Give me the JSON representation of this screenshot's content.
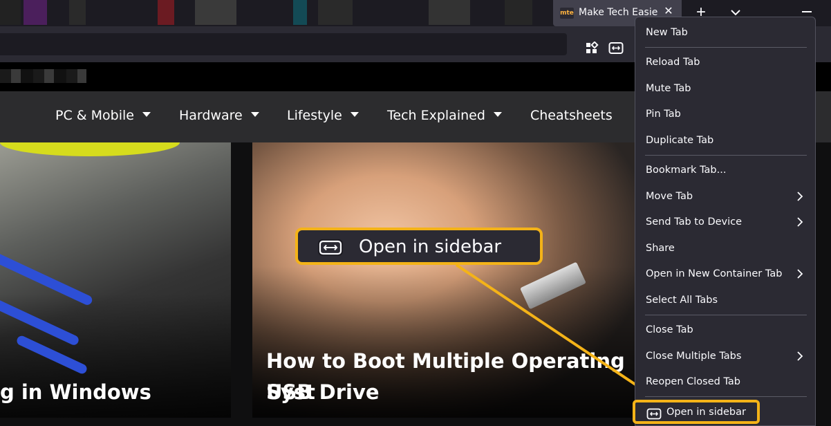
{
  "tab": {
    "favicon_text": "mte",
    "title": "Make Tech Easier",
    "close_glyph": "✕"
  },
  "tabstrip": {
    "new_tab_glyph": "+"
  },
  "site_nav": {
    "items": [
      {
        "label": "PC & Mobile",
        "has_caret": true
      },
      {
        "label": "Hardware",
        "has_caret": true
      },
      {
        "label": "Lifestyle",
        "has_caret": true
      },
      {
        "label": "Tech Explained",
        "has_caret": true
      },
      {
        "label": "Cheatsheets",
        "has_caret": false
      }
    ]
  },
  "cards": {
    "left_title": "g in Windows",
    "right_title_line1": "How to Boot Multiple Operating Syst",
    "right_title_line2": "USB Drive"
  },
  "callout": {
    "label": "Open in sidebar",
    "icon": "sidebar-icon",
    "color": "#f4b318"
  },
  "context_menu": {
    "new_tab": "New Tab",
    "reload_tab": "Reload Tab",
    "mute_tab": "Mute Tab",
    "pin_tab": "Pin Tab",
    "duplicate_tab": "Duplicate Tab",
    "bookmark_tab": "Bookmark Tab...",
    "move_tab": "Move Tab",
    "send_tab": "Send Tab to Device",
    "share": "Share",
    "open_container": "Open in New Container Tab",
    "select_all": "Select All Tabs",
    "close_tab": "Close Tab",
    "close_multiple": "Close Multiple Tabs",
    "reopen_closed": "Reopen Closed Tab",
    "open_sidebar": "Open in sidebar"
  },
  "colors": {
    "accent_highlight": "#f4b318",
    "menu_bg": "#2b2a33",
    "nav_bg": "#2c2c2e"
  }
}
